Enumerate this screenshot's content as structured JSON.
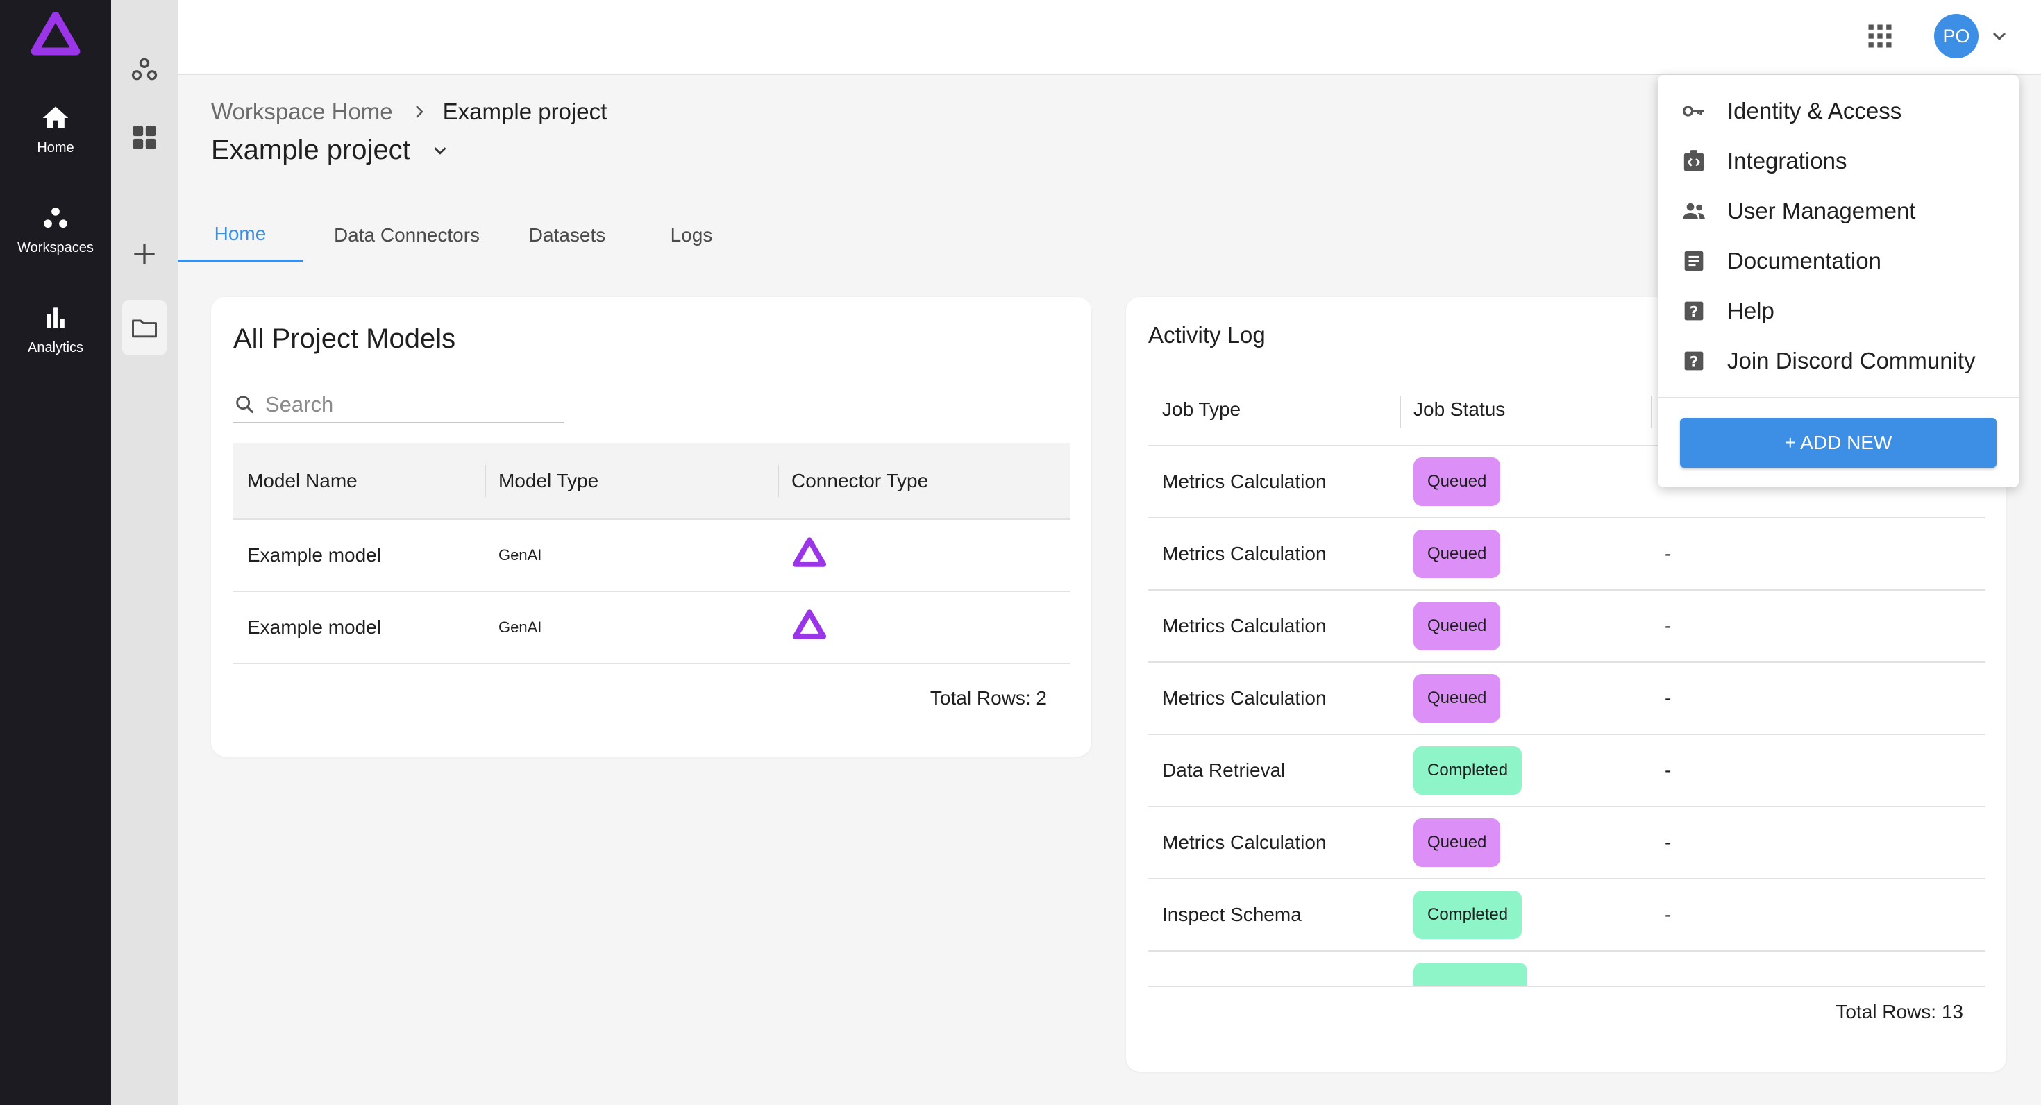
{
  "nav": {
    "home_label": "Home",
    "workspaces_label": "Workspaces",
    "analytics_label": "Analytics"
  },
  "topbar": {
    "avatar_initials": "PO"
  },
  "breadcrumb": {
    "parent": "Workspace Home",
    "current": "Example project"
  },
  "page_title": "Example project",
  "tabs": [
    "Home",
    "Data Connectors",
    "Datasets",
    "Logs"
  ],
  "models_card": {
    "title": "All Project Models",
    "search_placeholder": "Search",
    "columns": [
      "Model Name",
      "Model Type",
      "Connector Type"
    ],
    "rows": [
      {
        "name": "Example model",
        "type": "GenAI",
        "connector_icon": "arthur-logo-icon"
      },
      {
        "name": "Example model",
        "type": "GenAI",
        "connector_icon": "arthur-logo-icon"
      }
    ],
    "total": "Total Rows: 2"
  },
  "activity_card": {
    "title": "Activity Log",
    "columns": [
      "Job Type",
      "Job Status"
    ],
    "rows": [
      {
        "job_type": "Metrics Calculation",
        "status": "Queued",
        "extra": "-"
      },
      {
        "job_type": "Metrics Calculation",
        "status": "Queued",
        "extra": "-"
      },
      {
        "job_type": "Metrics Calculation",
        "status": "Queued",
        "extra": "-"
      },
      {
        "job_type": "Metrics Calculation",
        "status": "Queued",
        "extra": "-"
      },
      {
        "job_type": "Data Retrieval",
        "status": "Completed",
        "extra": "-"
      },
      {
        "job_type": "Metrics Calculation",
        "status": "Queued",
        "extra": "-"
      },
      {
        "job_type": "Inspect Schema",
        "status": "Completed",
        "extra": "-"
      }
    ],
    "total": "Total Rows: 13"
  },
  "menu": {
    "items": [
      {
        "label": "Identity & Access",
        "icon": "key-icon"
      },
      {
        "label": "Integrations",
        "icon": "integrations-icon"
      },
      {
        "label": "User Management",
        "icon": "people-icon"
      },
      {
        "label": "Documentation",
        "icon": "document-icon"
      },
      {
        "label": "Help",
        "icon": "help-icon"
      },
      {
        "label": "Join Discord Community",
        "icon": "help-icon"
      }
    ],
    "add_new_label": "+ ADD NEW"
  },
  "colors": {
    "brand_purple": "#9b35e8",
    "accent_blue": "#3d8ee5",
    "queued": "#dc8ff7",
    "completed": "#8ef5c9",
    "sidebar": "#1c1b22"
  }
}
